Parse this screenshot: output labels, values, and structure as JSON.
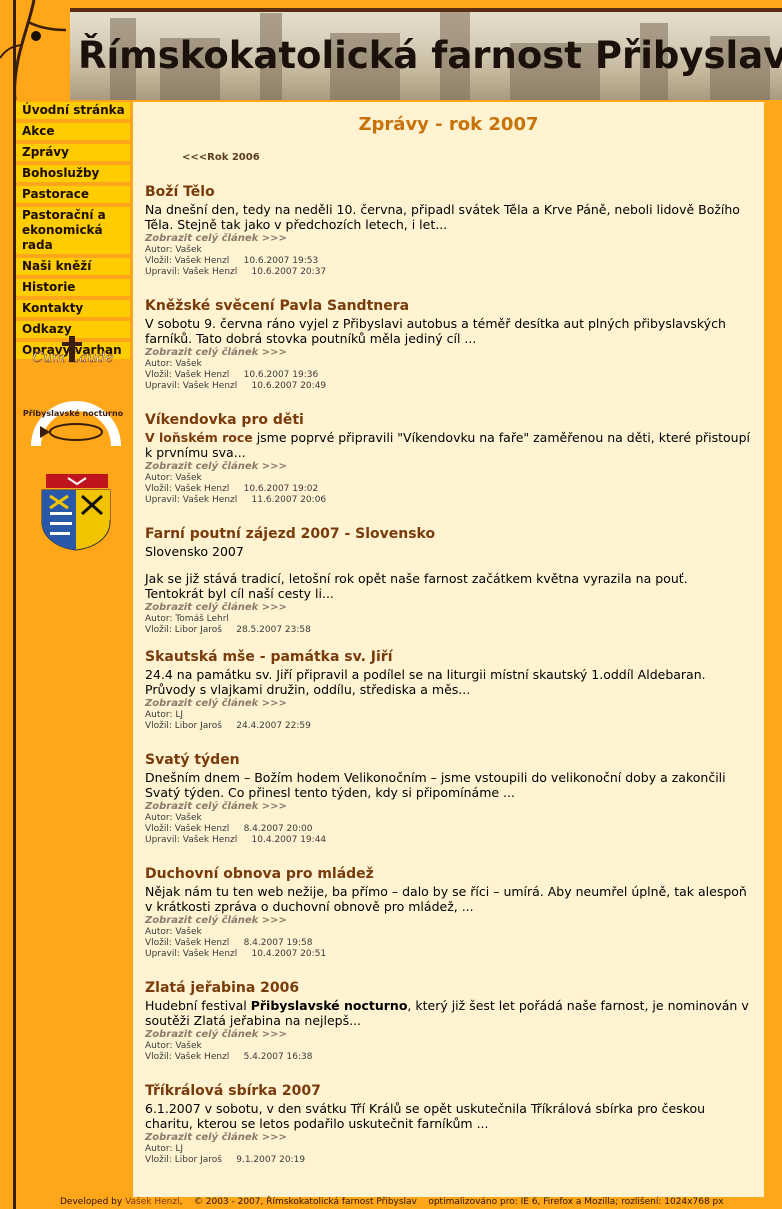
{
  "header": {
    "title": "Římskokatolická farnost Přibyslav"
  },
  "menu": [
    {
      "label": "Úvodní stránka"
    },
    {
      "label": "Akce"
    },
    {
      "label": "Zprávy"
    },
    {
      "label": "Bohoslužby"
    },
    {
      "label": "Pastorace"
    },
    {
      "label": "Pastorační a ekonomická rada"
    },
    {
      "label": "Naši kněží"
    },
    {
      "label": "Historie"
    },
    {
      "label": "Kontakty"
    },
    {
      "label": "Odkazy"
    },
    {
      "label": "Opravy varhan"
    }
  ],
  "logos": {
    "cum_laude": "Cum Laude",
    "nocturno": "Přibyslavské nocturno"
  },
  "page": {
    "title": "Zprávy - rok 2007",
    "prev_link": "<<<Rok 2006",
    "more_label": "Zobrazit celý článek >>>"
  },
  "articles": [
    {
      "title": "Boží Tělo",
      "text": "Na dnešní den, tedy na neděli 10. června, připadl svátek Těla a Krve Páně, neboli lidově Božího Těla. Stejně tak jako v předchozích letech, i let...",
      "meta": [
        "Autor: Vašek",
        "Vložil: Vašek Henzl     10.6.2007 19:53",
        "Upravil: Vašek Henzl     10.6.2007 20:37"
      ]
    },
    {
      "title": "Kněžské svěcení Pavla Sandtnera",
      "text": "V sobotu 9. června ráno vyjel z Přibyslavi autobus a téměř desítka aut plných přibyslavských farníků. Tato dobrá stovka poutníků měla jediný cíl ...",
      "meta": [
        "Autor: Vašek",
        "Vložil: Vašek Henzl     10.6.2007 19:36",
        "Upravil: Vašek Henzl     10.6.2007 20:49"
      ]
    },
    {
      "title": "Víkendovka pro děti",
      "text_link": "V loňském roce",
      "text": " jsme poprvé připravili \"Víkendovku na faře\" zaměřenou na děti, které přistoupí k prvnímu sva...",
      "meta": [
        "Autor: Vašek",
        "Vložil: Vašek Henzl     10.6.2007 19:02",
        "Upravil: Vašek Henzl     11.6.2007 20:06"
      ]
    },
    {
      "title": "Farní poutní zájezd 2007 - Slovensko",
      "subtitle": "Slovensko 2007",
      "text": "Jak se již stává tradicí, letošní rok opět naše farnost začátkem května vyrazila na pouť. Tentokrát byl cíl naší cesty li...",
      "meta": [
        "Autor: Tomáš Lehrl",
        "Vložil: Libor Jaroš     28.5.2007 23:58"
      ]
    },
    {
      "title": "Skautská mše - památka sv. Jiří",
      "text": "24.4 na památku sv. Jiří připravil a podílel se na liturgii místní skautský 1.oddíl Aldebaran. Průvody s vlajkami družin, oddílu, střediska a měs...",
      "meta": [
        "Autor: LJ",
        "Vložil: Libor Jaroš     24.4.2007 22:59"
      ]
    },
    {
      "title": "Svatý týden",
      "text": "Dnešním dnem – Božím hodem Velikonočním – jsme vstoupili do velikonoční doby a zakončili Svatý týden. Co přinesl tento týden, kdy si připomínáme ...",
      "meta": [
        "Autor: Vašek",
        "Vložil: Vašek Henzl     8.4.2007 20:00",
        "Upravil: Vašek Henzl     10.4.2007 19:44"
      ]
    },
    {
      "title": "Duchovní obnova pro mládež",
      "text": "Nějak nám tu ten web nežije, ba přímo – dalo by se říci – umírá. Aby neumřel úplně, tak alespoň v krátkosti zpráva o duchovní obnově pro mládež, ...",
      "meta": [
        "Autor: Vašek",
        "Vložil: Vašek Henzl     8.4.2007 19:58",
        "Upravil: Vašek Henzl     10.4.2007 20:51"
      ]
    },
    {
      "title": "Zlatá jeřabina 2006",
      "text_pre": "Hudební festival ",
      "text_bold": "Přibyslavské nocturno",
      "text": ", který již šest let pořádá naše farnost, je nominován v soutěži Zlatá jeřabina na nejlepš...",
      "meta": [
        "Autor: Vašek",
        "Vložil: Vašek Henzl     5.4.2007 16:38"
      ]
    },
    {
      "title": "Tříkrálová sbírka 2007",
      "text": "6.1.2007 v sobotu, v den svátku Tří Králů se opět uskutečnila Tříkrálová sbírka pro českou charitu, kterou se letos podařilo uskutečnit farníkům ...",
      "meta": [
        "Autor: LJ",
        "Vložil: Libor Jaroš     9.1.2007 20:19"
      ]
    }
  ],
  "footer": {
    "developed_by": "Developed by ",
    "author": "Vašek Henzl",
    "rest": ",    © 2003 - 2007, Římskokatolická farnost Přibyslav    optimalizováno pro: IE 6, Firefox a Mozilla; rozlišení: 1024x768 px"
  },
  "colors": {
    "background": "#ffa619",
    "menu_item": "#ffcc00",
    "content_bg": "#fff3d1",
    "title": "#7a3b0c",
    "heading": "#c8720a"
  }
}
